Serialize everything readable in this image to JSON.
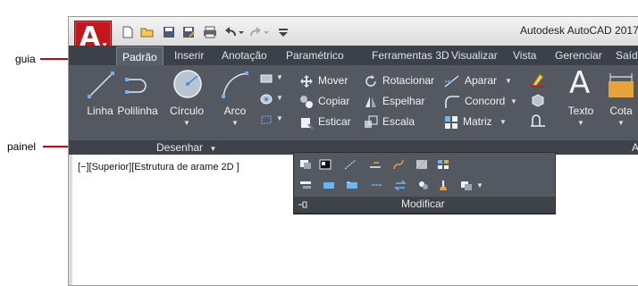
{
  "callouts": {
    "tab": "guia",
    "panel": "painel"
  },
  "window": {
    "title": "Autodesk AutoCAD 2017",
    "logo_letter": "A"
  },
  "quick_access": {
    "icons": [
      "new-icon",
      "open-icon",
      "save-icon",
      "save-as-icon",
      "print-icon",
      "undo-icon",
      "redo-icon",
      "customize-icon"
    ]
  },
  "ribbon_tabs": [
    {
      "label": "Padrão",
      "active": true
    },
    {
      "label": "Inserir"
    },
    {
      "label": "Anotação"
    },
    {
      "label": "Paramétrico"
    },
    {
      "label": "Ferramentas 3D"
    },
    {
      "label": "Visualizar"
    },
    {
      "label": "Vista"
    },
    {
      "label": "Gerenciar"
    },
    {
      "label": "Saída"
    }
  ],
  "draw_panel": {
    "title": "Desenhar",
    "tools": [
      {
        "label": "Linha",
        "icon": "line-icon"
      },
      {
        "label": "Polilinha",
        "icon": "polyline-icon"
      },
      {
        "label": "Círculo",
        "icon": "circle-icon"
      },
      {
        "label": "Arco",
        "icon": "arc-icon"
      }
    ]
  },
  "modify_panel": {
    "title": "Modificar",
    "tools": [
      {
        "label": "Mover",
        "icon": "move-icon"
      },
      {
        "label": "Rotacionar",
        "icon": "rotate-icon"
      },
      {
        "label": "Aparar",
        "icon": "trim-icon"
      },
      {
        "label": "Copiar",
        "icon": "copy-icon"
      },
      {
        "label": "Espelhar",
        "icon": "mirror-icon"
      },
      {
        "label": "Concord",
        "icon": "fillet-icon"
      },
      {
        "label": "Esticar",
        "icon": "stretch-icon"
      },
      {
        "label": "Escala",
        "icon": "scale-icon"
      },
      {
        "label": "Matriz",
        "icon": "array-icon"
      }
    ]
  },
  "annotation_panel": {
    "tools": [
      {
        "label": "Texto",
        "icon": "text-icon"
      },
      {
        "label": "Cota",
        "icon": "dimension-icon"
      }
    ],
    "title_fragment": "A"
  },
  "viewport": {
    "label": "[−][Superior][Estrutura de arame 2D ]"
  },
  "colors": {
    "accent": "#c4161c",
    "ribbon_bg": "#535861",
    "tab_bar_bg": "#3c4149",
    "callout_line": "#d40000"
  }
}
